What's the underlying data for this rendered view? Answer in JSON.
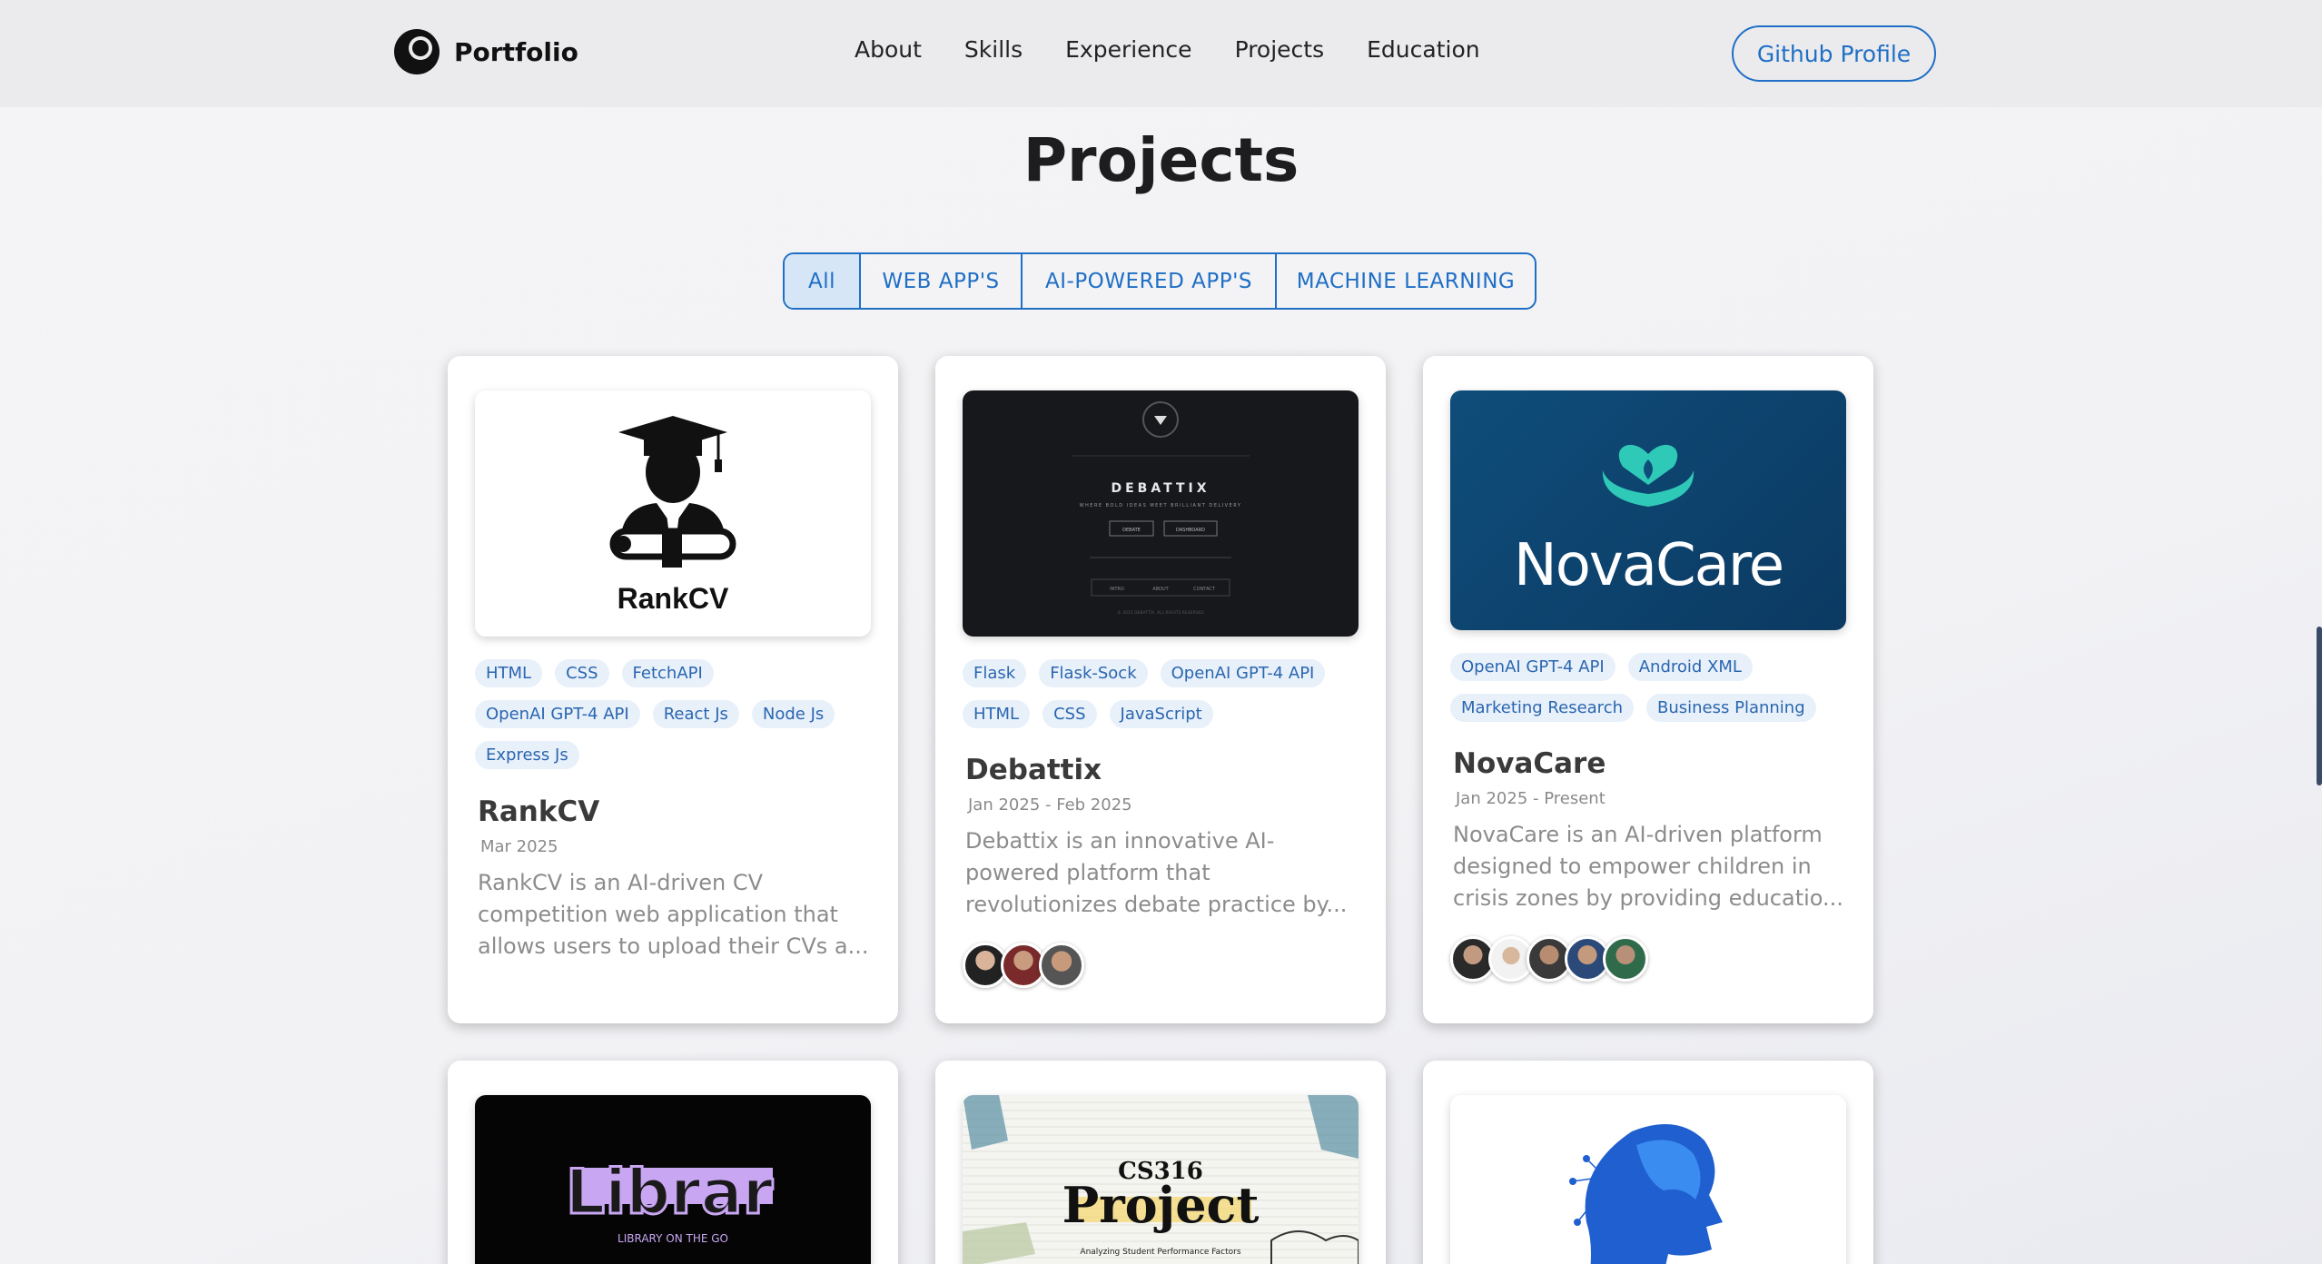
{
  "header": {
    "brand": "Portfolio",
    "nav": [
      "About",
      "Skills",
      "Experience",
      "Projects",
      "Education"
    ],
    "github_button": "Github Profile"
  },
  "section_title": "Projects",
  "filters": [
    "All",
    "WEB APP'S",
    "AI-POWERED APP'S",
    "MACHINE LEARNING"
  ],
  "active_filter": "All",
  "accent_color": "#1f6fc5",
  "cards": [
    {
      "image_label": "RankCV",
      "tags": [
        "HTML",
        "CSS",
        "FetchAPI",
        "OpenAI GPT-4 API",
        "React Js",
        "Node Js",
        "Express Js"
      ],
      "title": "RankCV",
      "date": "Mar 2025",
      "description": "RankCV is an AI-driven CV competition web application that allows users to upload their CVs a..."
    },
    {
      "image_label": "DEBATTIX",
      "image_tagline": "WHERE BOLD IDEAS MEET BRILLIANT DELIVERY",
      "image_buttons": [
        "DEBATE",
        "DASHBOARD"
      ],
      "image_footer_links": [
        "INTRO",
        "ABOUT",
        "CONTACT"
      ],
      "image_copyright": "© 2025 DEBATTIX. ALL RIGHTS RESERVED",
      "tags": [
        "Flask",
        "Flask-Sock",
        "OpenAI GPT-4 API",
        "HTML",
        "CSS",
        "JavaScript"
      ],
      "title": "Debattix",
      "date": "Jan 2025 - Feb 2025",
      "description": "Debattix is an innovative AI-powered platform that revolutionizes debate practice by...",
      "avatar_count": 3
    },
    {
      "image_label": "NovaCare",
      "tags": [
        "OpenAI GPT-4 API",
        "Android XML",
        "Marketing Research",
        "Business Planning"
      ],
      "title": "NovaCare",
      "date": "Jan 2025 - Present",
      "description": "NovaCare is an AI-driven platform designed to empower children in crisis zones by providing educatio...",
      "avatar_count": 5
    },
    {
      "image_label": "Librar",
      "image_sublabel": "LIBRARY ON THE GO"
    },
    {
      "image_label_small": "CS316",
      "image_label": "Project",
      "image_sublabel": "Analyzing Student Performance Factors"
    },
    {
      "image_label": ""
    }
  ]
}
